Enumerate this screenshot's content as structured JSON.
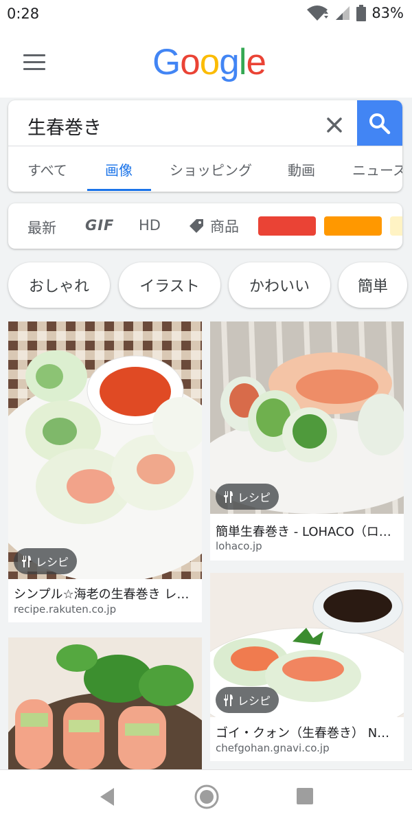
{
  "status_bar": {
    "time": "0:28",
    "battery": "83%"
  },
  "header": {
    "logo_letters": [
      "G",
      "o",
      "o",
      "g",
      "l",
      "e"
    ],
    "logo_colors": [
      "#4285f4",
      "#ea4335",
      "#fbbc05",
      "#4285f4",
      "#34a853",
      "#ea4335"
    ]
  },
  "search": {
    "query": "生春巻き"
  },
  "tabs": [
    {
      "label": "すべて"
    },
    {
      "label": "画像",
      "active": true
    },
    {
      "label": "ショッピング"
    },
    {
      "label": "動画"
    },
    {
      "label": "ニュース"
    }
  ],
  "filters": {
    "newest": "最新",
    "gif": "GIF",
    "hd": "HD",
    "product": "商品",
    "colors": [
      "#ea4335",
      "#ff9800",
      "#fff3c4"
    ]
  },
  "chips": [
    "おしゃれ",
    "イラスト",
    "かわいい",
    "簡単"
  ],
  "results": [
    {
      "badge": "レシピ",
      "title": "シンプル☆海老の生春巻き レ…",
      "domain": "recipe.rakuten.co.jp"
    },
    {
      "badge": "レシピ",
      "title": "簡単生春巻き - LOHACO（ロ…",
      "domain": "lohaco.jp"
    },
    {
      "badge": "レシピ",
      "title": "ゴイ・クォン（生春巻き） N…",
      "domain": "chefgohan.gnavi.co.jp"
    },
    {
      "badge": "",
      "title": "",
      "domain": ""
    }
  ],
  "accent": "#1a73e8"
}
